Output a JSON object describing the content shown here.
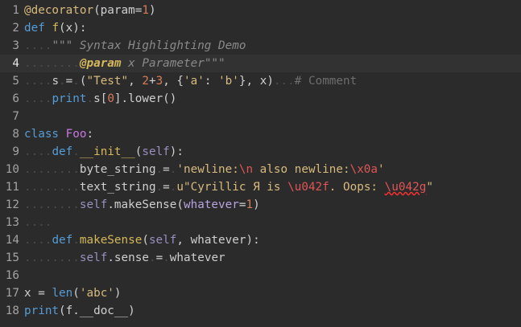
{
  "editor": {
    "current_line": 4,
    "lines": [
      {
        "n": "1",
        "tokens": [
          [
            "dec",
            "@decorator"
          ],
          [
            "op",
            "(param"
          ],
          [
            "op",
            "="
          ],
          [
            "num",
            "1"
          ],
          [
            "op",
            ")"
          ]
        ]
      },
      {
        "n": "2",
        "tokens": [
          [
            "kw",
            "def"
          ],
          [
            "op",
            " "
          ],
          [
            "fn",
            "f"
          ],
          [
            "op",
            "(x):"
          ]
        ]
      },
      {
        "n": "3",
        "tokens": [
          [
            "ws",
            "...."
          ],
          [
            "doc",
            "\"\"\" Syntax Highlighting Demo"
          ]
        ]
      },
      {
        "n": "4",
        "tokens": [
          [
            "ws",
            "........"
          ],
          [
            "doctag",
            "@param"
          ],
          [
            "doc",
            " x Parameter\"\"\""
          ]
        ]
      },
      {
        "n": "5",
        "tokens": [
          [
            "ws",
            "...."
          ],
          [
            "op",
            "s"
          ],
          [
            "ws",
            "."
          ],
          [
            "op",
            "="
          ],
          [
            "ws",
            "."
          ],
          [
            "op",
            "("
          ],
          [
            "str",
            "\"Test\""
          ],
          [
            "op",
            ", "
          ],
          [
            "num",
            "2"
          ],
          [
            "op",
            "+"
          ],
          [
            "num",
            "3"
          ],
          [
            "op",
            ", {"
          ],
          [
            "str",
            "'a'"
          ],
          [
            "op",
            ": "
          ],
          [
            "str",
            "'b'"
          ],
          [
            "op",
            "}, x)"
          ],
          [
            "ws",
            "..."
          ],
          [
            "cmt",
            "# Comment"
          ]
        ]
      },
      {
        "n": "6",
        "tokens": [
          [
            "ws",
            "...."
          ],
          [
            "kw",
            "print"
          ],
          [
            "ws",
            "."
          ],
          [
            "op",
            "s["
          ],
          [
            "num",
            "0"
          ],
          [
            "op",
            "].lower()"
          ]
        ]
      },
      {
        "n": "7",
        "tokens": []
      },
      {
        "n": "8",
        "tokens": [
          [
            "kw",
            "class"
          ],
          [
            "op",
            " "
          ],
          [
            "cls",
            "Foo"
          ],
          [
            "op",
            ":"
          ]
        ]
      },
      {
        "n": "9",
        "tokens": [
          [
            "ws",
            "...."
          ],
          [
            "kw",
            "def"
          ],
          [
            "ws",
            "."
          ],
          [
            "fn",
            "__init__"
          ],
          [
            "op",
            "("
          ],
          [
            "self",
            "self"
          ],
          [
            "op",
            "):"
          ]
        ]
      },
      {
        "n": "10",
        "tokens": [
          [
            "ws",
            "........"
          ],
          [
            "op",
            "byte_string"
          ],
          [
            "ws",
            "."
          ],
          [
            "op",
            "="
          ],
          [
            "ws",
            "."
          ],
          [
            "str",
            "'newline:"
          ],
          [
            "esc",
            "\\n"
          ],
          [
            "str",
            " also newline:"
          ],
          [
            "esc",
            "\\x0a"
          ],
          [
            "str",
            "'"
          ]
        ]
      },
      {
        "n": "11",
        "tokens": [
          [
            "ws",
            "........"
          ],
          [
            "op",
            "text_string"
          ],
          [
            "ws",
            "."
          ],
          [
            "op",
            "="
          ],
          [
            "ws",
            "."
          ],
          [
            "str",
            "u\"Cyrillic Я is "
          ],
          [
            "esc",
            "\\u042f"
          ],
          [
            "str",
            ". Oops: "
          ],
          [
            "escerr",
            "\\u042g"
          ],
          [
            "str",
            "\""
          ]
        ]
      },
      {
        "n": "12",
        "tokens": [
          [
            "ws",
            "........"
          ],
          [
            "self",
            "self"
          ],
          [
            "op",
            ".makeSense("
          ],
          [
            "param",
            "whatever"
          ],
          [
            "op",
            "="
          ],
          [
            "num",
            "1"
          ],
          [
            "op",
            ")"
          ]
        ]
      },
      {
        "n": "13",
        "tokens": [
          [
            "ws",
            "...."
          ]
        ]
      },
      {
        "n": "14",
        "tokens": [
          [
            "ws",
            "...."
          ],
          [
            "kw",
            "def"
          ],
          [
            "ws",
            "."
          ],
          [
            "fn",
            "makeSense"
          ],
          [
            "op",
            "("
          ],
          [
            "self",
            "self"
          ],
          [
            "op",
            ", "
          ],
          [
            "op",
            "whatever):"
          ]
        ]
      },
      {
        "n": "15",
        "tokens": [
          [
            "ws",
            "........"
          ],
          [
            "self",
            "self"
          ],
          [
            "op",
            ".sense"
          ],
          [
            "ws",
            "."
          ],
          [
            "op",
            "="
          ],
          [
            "ws",
            "."
          ],
          [
            "op",
            "whatever"
          ]
        ]
      },
      {
        "n": "16",
        "tokens": []
      },
      {
        "n": "17",
        "tokens": [
          [
            "op",
            "x = "
          ],
          [
            "kw",
            "len"
          ],
          [
            "op",
            "("
          ],
          [
            "str",
            "'abc'"
          ],
          [
            "op",
            ")"
          ]
        ]
      },
      {
        "n": "18",
        "tokens": [
          [
            "kw",
            "print"
          ],
          [
            "op",
            "(f.__doc__)"
          ]
        ]
      }
    ]
  }
}
